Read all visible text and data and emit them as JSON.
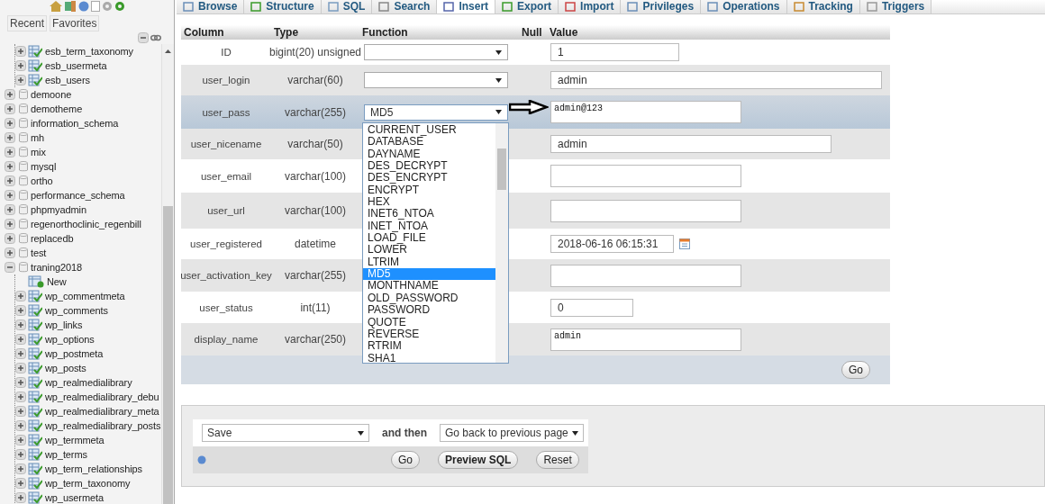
{
  "sidebar": {
    "tabs": [
      {
        "label": "Recent",
        "selected": false
      },
      {
        "label": "Favorites",
        "selected": false
      }
    ],
    "tree": [
      {
        "kind": "continued",
        "children": [
          {
            "kind": "table",
            "label": "esb_term_taxonomy",
            "expanded": false
          },
          {
            "kind": "table",
            "label": "esb_usermeta",
            "expanded": false
          },
          {
            "kind": "table",
            "label": "esb_users",
            "expanded": false
          }
        ]
      },
      {
        "kind": "database",
        "label": "demoone",
        "expanded": false
      },
      {
        "kind": "database",
        "label": "demotheme",
        "expanded": false
      },
      {
        "kind": "database",
        "label": "information_schema",
        "expanded": false
      },
      {
        "kind": "database",
        "label": "mh",
        "expanded": false
      },
      {
        "kind": "database",
        "label": "mix",
        "expanded": false
      },
      {
        "kind": "database",
        "label": "mysql",
        "expanded": false
      },
      {
        "kind": "database",
        "label": "ortho",
        "expanded": false
      },
      {
        "kind": "database",
        "label": "performance_schema",
        "expanded": false
      },
      {
        "kind": "database",
        "label": "phpmyadmin",
        "expanded": false
      },
      {
        "kind": "database",
        "label": "regenorthoclinic_regenbill",
        "expanded": false
      },
      {
        "kind": "database",
        "label": "replacedb",
        "expanded": false
      },
      {
        "kind": "database",
        "label": "test",
        "expanded": false
      },
      {
        "kind": "database",
        "label": "traning2018",
        "expanded": true,
        "children": [
          {
            "kind": "new",
            "label": "New"
          },
          {
            "kind": "table",
            "label": "wp_commentmeta",
            "expanded": false
          },
          {
            "kind": "table",
            "label": "wp_comments",
            "expanded": false
          },
          {
            "kind": "table",
            "label": "wp_links",
            "expanded": false
          },
          {
            "kind": "table",
            "label": "wp_options",
            "expanded": false
          },
          {
            "kind": "table",
            "label": "wp_postmeta",
            "expanded": false
          },
          {
            "kind": "table",
            "label": "wp_posts",
            "expanded": false
          },
          {
            "kind": "table",
            "label": "wp_realmedialibrary",
            "expanded": false
          },
          {
            "kind": "table",
            "label": "wp_realmedialibrary_debu",
            "expanded": false
          },
          {
            "kind": "table",
            "label": "wp_realmedialibrary_meta",
            "expanded": false
          },
          {
            "kind": "table",
            "label": "wp_realmedialibrary_posts",
            "expanded": false
          },
          {
            "kind": "table",
            "label": "wp_termmeta",
            "expanded": false
          },
          {
            "kind": "table",
            "label": "wp_terms",
            "expanded": false
          },
          {
            "kind": "table",
            "label": "wp_term_relationships",
            "expanded": false
          },
          {
            "kind": "table",
            "label": "wp_term_taxonomy",
            "expanded": false
          },
          {
            "kind": "table",
            "label": "wp_usermeta",
            "expanded": false
          }
        ]
      }
    ]
  },
  "tabs": [
    {
      "label": "Browse",
      "selected": false
    },
    {
      "label": "Structure",
      "selected": false
    },
    {
      "label": "SQL",
      "selected": false
    },
    {
      "label": "Search",
      "selected": false
    },
    {
      "label": "Insert",
      "selected": true
    },
    {
      "label": "Export",
      "selected": false
    },
    {
      "label": "Import",
      "selected": false
    },
    {
      "label": "Privileges",
      "selected": false
    },
    {
      "label": "Operations",
      "selected": false
    },
    {
      "label": "Tracking",
      "selected": false
    },
    {
      "label": "Triggers",
      "selected": false
    }
  ],
  "table": {
    "columns": [
      "Column",
      "Type",
      "Function",
      "Null",
      "Value"
    ],
    "rows": [
      {
        "name": "ID",
        "type": "bigint(20) unsigned",
        "highlighted": false,
        "function_select": true,
        "value": {
          "kind": "input",
          "text": "1"
        }
      },
      {
        "name": "user_login",
        "type": "varchar(60)",
        "highlighted": false,
        "function_select": true,
        "value": {
          "kind": "input",
          "text": "admin"
        }
      },
      {
        "name": "user_pass",
        "type": "varchar(255)",
        "highlighted": true,
        "function_select": true,
        "function_value": "MD5",
        "value": {
          "kind": "textarea",
          "text": "admin@123"
        }
      },
      {
        "name": "user_nicename",
        "type": "varchar(50)",
        "highlighted": false,
        "function_select": false,
        "value": {
          "kind": "input",
          "text": "admin"
        }
      },
      {
        "name": "user_email",
        "type": "varchar(100)",
        "highlighted": false,
        "function_select": false,
        "value": {
          "kind": "textarea"
        }
      },
      {
        "name": "user_url",
        "type": "varchar(100)",
        "highlighted": false,
        "function_select": false,
        "value": {
          "kind": "textarea"
        }
      },
      {
        "name": "user_registered",
        "type": "datetime",
        "highlighted": false,
        "function_select": false,
        "value": {
          "kind": "datetime",
          "text": "2018-06-16 06:15:31"
        }
      },
      {
        "name": "user_activation_key",
        "type": "varchar(255)",
        "highlighted": false,
        "function_select": false,
        "value": {
          "kind": "textarea"
        }
      },
      {
        "name": "user_status",
        "type": "int(11)",
        "highlighted": false,
        "function_select": false,
        "value": {
          "kind": "input",
          "text": "0"
        }
      },
      {
        "name": "display_name",
        "type": "varchar(250)",
        "highlighted": false,
        "function_select": false,
        "value": {
          "kind": "textarea",
          "text": "admin"
        }
      }
    ],
    "go": "Go"
  },
  "function_list": {
    "options": [
      {
        "label": "CURRENT_USER",
        "selected": false
      },
      {
        "label": "DATABASE",
        "selected": false
      },
      {
        "label": "DAYNAME",
        "selected": false
      },
      {
        "label": "DES_DECRYPT",
        "selected": false
      },
      {
        "label": "DES_ENCRYPT",
        "selected": false
      },
      {
        "label": "ENCRYPT",
        "selected": false
      },
      {
        "label": "HEX",
        "selected": false
      },
      {
        "label": "INET6_NTOA",
        "selected": false
      },
      {
        "label": "INET_NTOA",
        "selected": false
      },
      {
        "label": "LOAD_FILE",
        "selected": false
      },
      {
        "label": "LOWER",
        "selected": false
      },
      {
        "label": "LTRIM",
        "selected": false
      },
      {
        "label": "MD5",
        "selected": true
      },
      {
        "label": "MONTHNAME",
        "selected": false
      },
      {
        "label": "OLD_PASSWORD",
        "selected": false
      },
      {
        "label": "PASSWORD",
        "selected": false
      },
      {
        "label": "QUOTE",
        "selected": false
      },
      {
        "label": "REVERSE",
        "selected": false
      },
      {
        "label": "RTRIM",
        "selected": false
      },
      {
        "label": "SHA1",
        "selected": false
      }
    ]
  },
  "annotation": {
    "kind": "arrow"
  },
  "after_insert": {
    "action": "Save",
    "and_then": "and then",
    "next": "Go back to previous page",
    "buttons": [
      "Go",
      "Preview SQL",
      "Reset"
    ]
  }
}
